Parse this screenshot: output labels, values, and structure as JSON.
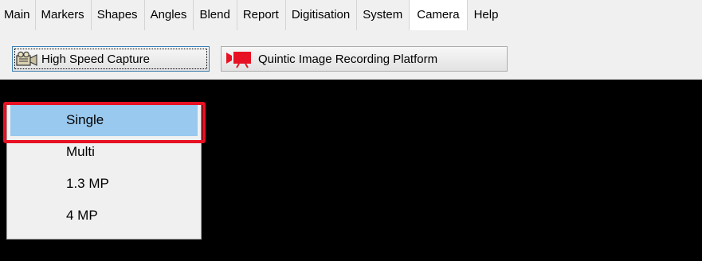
{
  "tabs": [
    {
      "label": "Main"
    },
    {
      "label": "Markers"
    },
    {
      "label": "Shapes"
    },
    {
      "label": "Angles"
    },
    {
      "label": "Blend"
    },
    {
      "label": "Report"
    },
    {
      "label": "Digitisation"
    },
    {
      "label": "System"
    },
    {
      "label": "Camera",
      "active": true
    },
    {
      "label": "Help"
    }
  ],
  "toolbar": {
    "high_speed_capture": {
      "label": "High Speed Capture",
      "icon": "camcorder-icon"
    },
    "recording_platform": {
      "label": "Quintic Image Recording Platform",
      "icon": "video-camera-icon"
    }
  },
  "dropdown": {
    "items": [
      {
        "label": "Single",
        "selected": true
      },
      {
        "label": "Multi"
      },
      {
        "label": "1.3 MP"
      },
      {
        "label": "4 MP"
      }
    ]
  },
  "colors": {
    "viewport_bg": "#000000",
    "selection": "#99c9ef",
    "highlight_border": "#e81123",
    "camera_icon": "#e81123"
  }
}
